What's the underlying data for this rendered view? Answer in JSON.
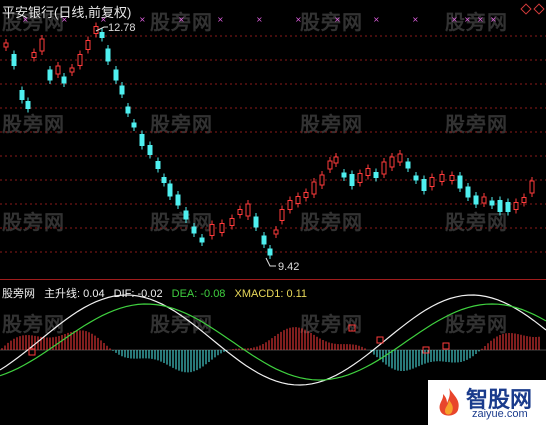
{
  "chart_title": "平安银行(日线,前复权)",
  "price_chart": {
    "high_label": "12.78",
    "low_label": "9.42",
    "colors": {
      "up": "#ff3b3b",
      "down": "#4ff0f0",
      "grid": "#8a1a1a",
      "signal": "#e060e0"
    }
  },
  "indicator": {
    "name": "股旁网",
    "main_label": "主升线: 0.04",
    "dif_label": "DIF: -0.02",
    "dea_label": "DEA: -0.08",
    "xmacd_label": "XMACD1: 0.11",
    "colors": {
      "dif": "#f0f0f0",
      "dea": "#3fd03f",
      "hist_pos": "#ff3b3b",
      "hist_neg": "#4ff0f0",
      "marker": "#ff3b3b"
    }
  },
  "watermarks": [
    "股旁网",
    "股旁网",
    "股旁网",
    "股旁网",
    "股旁网",
    "股旁网",
    "股旁网",
    "股旁网",
    "股旁网",
    "股旁网",
    "股旁网",
    "股旁网",
    "股旁网",
    "股旁网",
    "股旁网",
    "股旁网"
  ],
  "brand": {
    "name": "智股网",
    "url": "zaiyue.com",
    "icon": "flame-icon"
  },
  "corner_icons": [
    "diamond-icon",
    "diamond-icon"
  ]
}
